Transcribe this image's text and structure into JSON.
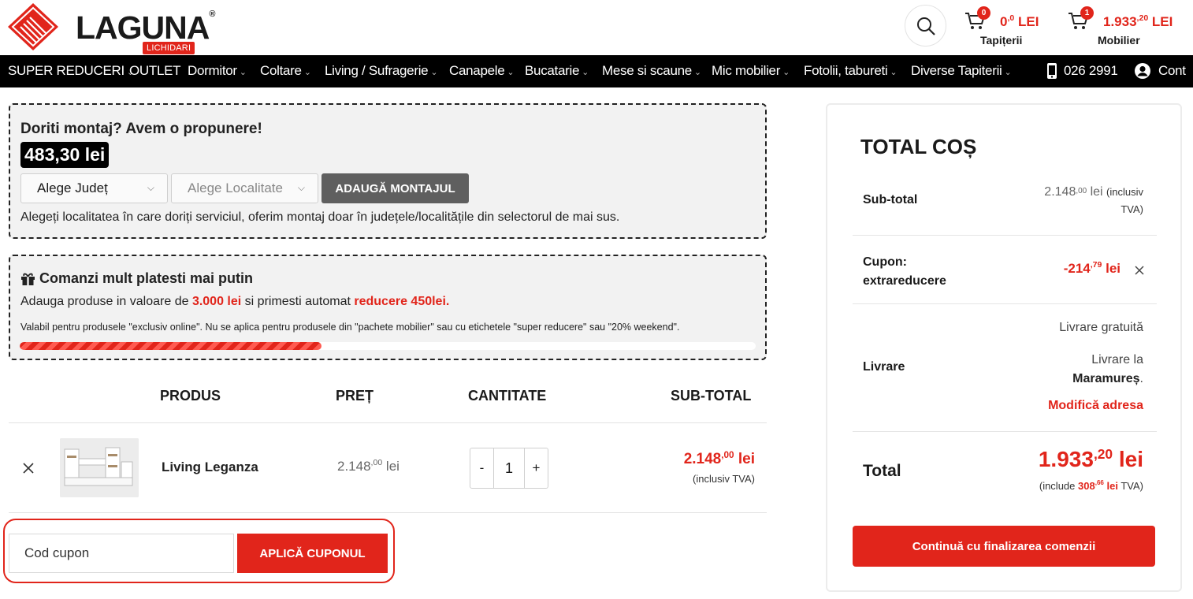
{
  "header": {
    "logo_text": "LAGUNA",
    "logo_reg": "®",
    "carts": [
      {
        "count": "0",
        "amount_main": "0",
        "amount_sup": ",0",
        "currency": " LEI",
        "label": "Tapițerii"
      },
      {
        "count": "1",
        "amount_main": "1.933",
        "amount_sup": ",20",
        "currency": " LEI",
        "label": "Mobilier"
      }
    ]
  },
  "nav": {
    "items": [
      "SUPER REDUCERI",
      "OUTLET",
      "Dormitor",
      "Coltare",
      "Living / Sufragerie",
      "Canapele",
      "Bucatarie",
      "Mese si scaune",
      "Mic mobilier",
      "Fotolii, tabureti",
      "Diverse Tapiterii"
    ],
    "badge": "LICHIDARI",
    "phone": "026 2991",
    "account": "Cont"
  },
  "assembly": {
    "title": "Doriti montaj? Avem o propunere!",
    "price": "483,30 lei",
    "county_placeholder": "Alege Județ",
    "locality_placeholder": "Alege Localitate",
    "button": "ADAUGĂ MONTAJUL",
    "note": "Alegeți localitatea în care doriți serviciul, oferim montaj doar în județele/localitățile din selectorul de mai sus."
  },
  "promo": {
    "title": "Comanzi mult platesti mai putin",
    "line_pre": "Adauga produse in valoare de ",
    "line_amount": "3.000 lei",
    "line_mid": " si primesti automat ",
    "line_discount": "reducere 450lei.",
    "fine_print": "Valabil pentru produsele \"exclusiv online\". Nu se aplica pentru produsele din \"pachete mobilier\" sau cu etichetele \"super reducere\" sau \"20% weekend\".",
    "progress": 0.41
  },
  "cart_table": {
    "headers": {
      "product": "PRODUS",
      "price": "PREȚ",
      "quantity": "CANTITATE",
      "subtotal": "SUB-TOTAL"
    },
    "rows": [
      {
        "name": "Living Leganza",
        "price_main": "2.148",
        "price_sup": ",00",
        "price_unit": " lei",
        "quantity": "1",
        "subtotal_main": "2.148",
        "subtotal_sup": ",00",
        "subtotal_unit": " lei",
        "subtotal_note": "(inclusiv TVA)"
      }
    ],
    "qty_minus": "-",
    "qty_plus": "+"
  },
  "coupon": {
    "placeholder": "Cod cupon",
    "button": "APLICĂ CUPONUL"
  },
  "summary": {
    "title": "TOTAL COȘ",
    "subtotal_label": "Sub-total",
    "subtotal_main": "2.148",
    "subtotal_sup": ",00",
    "subtotal_unit": " lei",
    "subtotal_note_1": "(inclusiv",
    "subtotal_note_2": "TVA)",
    "coupon_label_1": "Cupon:",
    "coupon_label_2": "extrareducere",
    "coupon_main": "-214",
    "coupon_sup": ",79",
    "coupon_unit": " lei",
    "delivery_label": "Livrare",
    "delivery_free": "Livrare gratuită",
    "delivery_to_1": "Livrare la",
    "delivery_to_2": "Maramureș",
    "delivery_change": "Modifică adresa",
    "total_label": "Total",
    "total_main": "1.933",
    "total_sup": ",20",
    "total_unit": " lei",
    "vat_pre": "(include ",
    "vat_main": "308",
    "vat_sup": ",66",
    "vat_unit": " lei",
    "vat_post": " TVA)",
    "checkout": "Continuă cu finalizarea comenzii"
  },
  "colors": {
    "accent": "#e1251b",
    "nav_bg": "#000000"
  }
}
